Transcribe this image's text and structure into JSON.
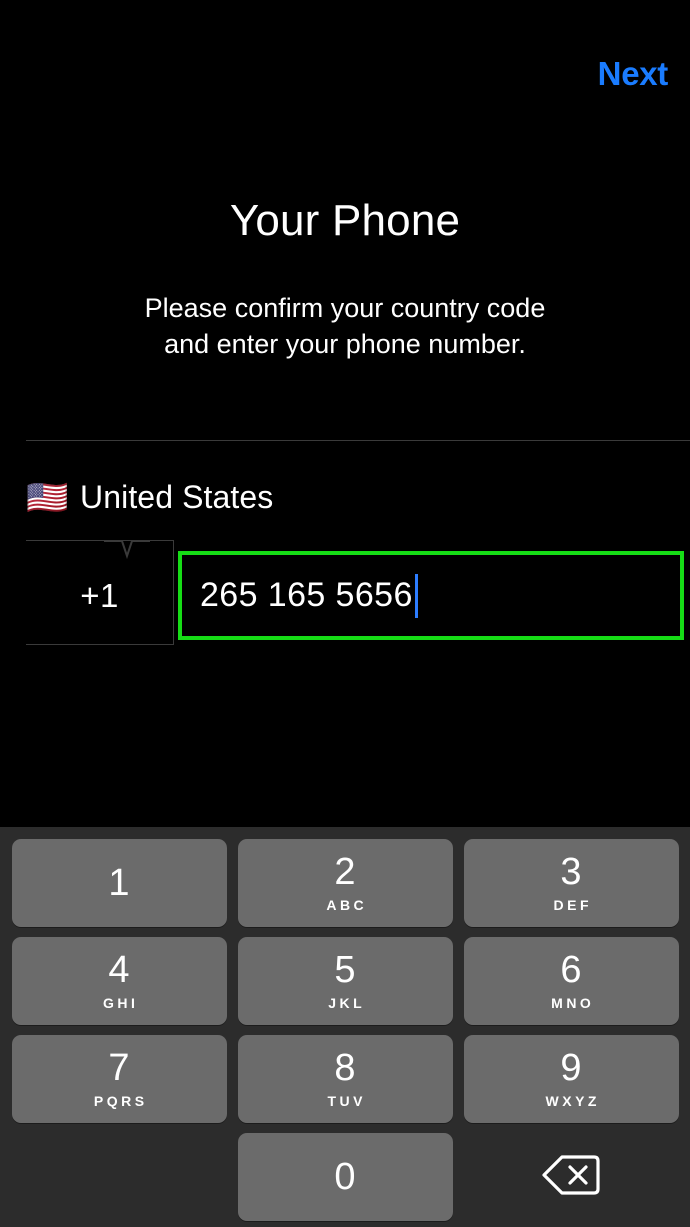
{
  "topbar": {
    "next_label": "Next",
    "next_color": "#1a7cff"
  },
  "header": {
    "title": "Your Phone",
    "subtitle": "Please confirm your country code\nand enter your phone number."
  },
  "form": {
    "flag": "🇺🇸",
    "country_name": "United States",
    "country_code": "+1",
    "phone_number": "265 165 5656",
    "phone_placeholder": "",
    "highlight_color": "#16dd16",
    "caret_color": "#2d7dff"
  },
  "keypad": {
    "background_color": "#2c2c2c",
    "key_color": "#6b6b6b",
    "rows": [
      [
        {
          "digit": "1",
          "letters": ""
        },
        {
          "digit": "2",
          "letters": "ABC"
        },
        {
          "digit": "3",
          "letters": "DEF"
        }
      ],
      [
        {
          "digit": "4",
          "letters": "GHI"
        },
        {
          "digit": "5",
          "letters": "JKL"
        },
        {
          "digit": "6",
          "letters": "MNO"
        }
      ],
      [
        {
          "digit": "7",
          "letters": "PQRS"
        },
        {
          "digit": "8",
          "letters": "TUV"
        },
        {
          "digit": "9",
          "letters": "WXYZ"
        }
      ]
    ],
    "zero_key": {
      "digit": "0",
      "letters": ""
    },
    "delete_icon": "backspace-icon"
  }
}
